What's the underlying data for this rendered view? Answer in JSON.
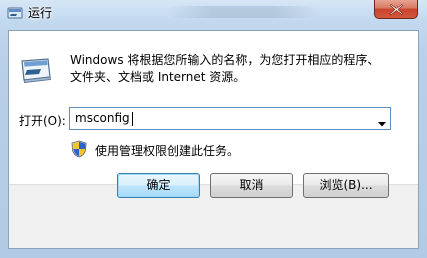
{
  "window": {
    "title": "运行",
    "close_icon": "close-icon"
  },
  "content": {
    "description_line1": "Windows 将根据您所输入的名称，为您打开相应的程序、",
    "description_line2": "文件夹、文档或 Internet 资源。",
    "run_icon": "run-program-icon"
  },
  "open_field": {
    "label": "打开(O):",
    "value": "msconfig"
  },
  "admin_note": {
    "icon": "uac-shield-icon",
    "text": "使用管理权限创建此任务。"
  },
  "buttons": {
    "ok": "确定",
    "cancel": "取消",
    "browse": "浏览(B)..."
  },
  "colors": {
    "close_button": "#c8442c",
    "default_button_border": "#3c7fb1",
    "field_border": "#5b8fc8"
  }
}
